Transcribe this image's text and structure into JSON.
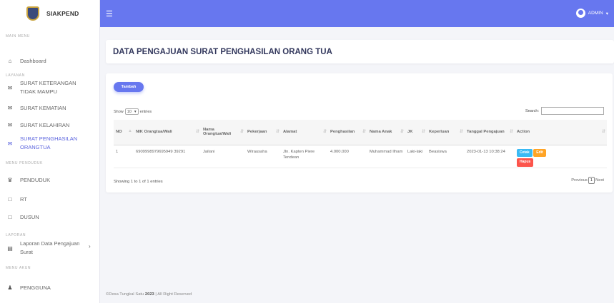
{
  "app": {
    "name": "SIAKPEND"
  },
  "sidebar": {
    "sections": {
      "main": "MAIN MENU",
      "layanan": "LAYANAN",
      "penduduk": "MENU PENDUDUK",
      "laporan": "LAPORAN",
      "akun": "MENU AKUN"
    },
    "items": [
      {
        "label": "Dashboard",
        "icon": "home-icon"
      },
      {
        "label": "SURAT KETERANGAN",
        "label2": "TIDAK MAMPU",
        "icon": "envelope-icon"
      },
      {
        "label": "SURAT KEMATIAN",
        "icon": "envelope-icon"
      },
      {
        "label": "SURAT KELAHIRAN",
        "icon": "envelope-icon"
      },
      {
        "label": "SURAT PENGHASILAN",
        "label2": "ORANGTUA",
        "icon": "envelope-icon"
      },
      {
        "label": "PENDUDUK",
        "icon": "users-icon"
      },
      {
        "label": "RT",
        "icon": "square-icon"
      },
      {
        "label": "DUSUN",
        "icon": "square-icon"
      },
      {
        "label": "Laporan Data Pengajuan",
        "label2": "Surat",
        "icon": "book-icon"
      },
      {
        "label": "PENGGUNA",
        "icon": "user-icon"
      }
    ]
  },
  "topbar": {
    "user": "ADMIN"
  },
  "page": {
    "title": "DATA PENGAJUAN SURAT PENGHASILAN ORANG TUA"
  },
  "table": {
    "add_label": "Tambah",
    "show_label": "Show",
    "entries_value": "10",
    "entries_label": "entries",
    "search_label": "Search:",
    "columns": [
      "NO",
      "NIK Orangtua/Wali",
      "Nama Orangtua/Wali",
      "Pekerjaan",
      "Alamat",
      "Penghasilan",
      "Nama Anak",
      "JK",
      "Keperluan",
      "Tanggal Pengajuan",
      "Action"
    ],
    "rows": [
      {
        "no": "1",
        "nik": "6909998979695949 39291",
        "nama": "Jailani",
        "pekerjaan": "Wirausaha",
        "alamat": "Jln. Kapten Piere Tendean",
        "penghasilan": "4.000.000",
        "anak": "Muhammad Ilham",
        "jk": "Laki-laki",
        "keperluan": "Beasiswa",
        "tanggal": "2023-01-13 10:38:24"
      }
    ],
    "actions": {
      "print": "Cetak",
      "edit": "Edit",
      "delete": "Hapus"
    },
    "info": "Showing 1 to 1 of 1 entries",
    "pager": {
      "prev": "Previous",
      "page": "1",
      "next": "Next"
    }
  },
  "footer": {
    "text": "©Desa Tungkal Satu",
    "year": "2023",
    "rights": "| All Right Reserved"
  }
}
